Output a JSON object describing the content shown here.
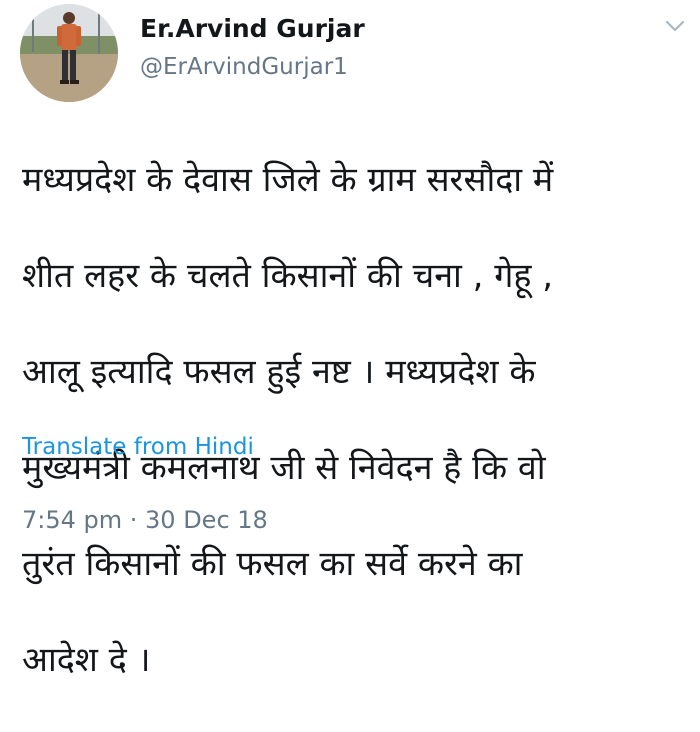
{
  "user": {
    "display_name": "Er.Arvind Gurjar",
    "username": "@ErArvindGurjar1",
    "avatar_icon": "profile-photo"
  },
  "tweet": {
    "lines": [
      "मध्यप्रदेश के देवास जिले के ग्राम सरसौदा में",
      "शीत लहर के चलते किसानों की चना , गेहू ,",
      "आलू इत्यादि फसल हुई नष्ट  । मध्यप्रदेश के",
      "मुख्यमंत्री कमलनाथ जी से निवेदन है कि वो",
      "तुरंत किसानों की फसल का सर्वे करने का",
      "आदेश दे ।"
    ],
    "translate_label": "Translate from Hindi",
    "timestamp": "7:54 pm · 30 Dec 18"
  },
  "menu": {
    "caret_icon": "chevron-down-icon"
  },
  "colors": {
    "text": "#14171a",
    "secondary": "#657786",
    "link": "#1b95e0",
    "background": "#ffffff"
  }
}
